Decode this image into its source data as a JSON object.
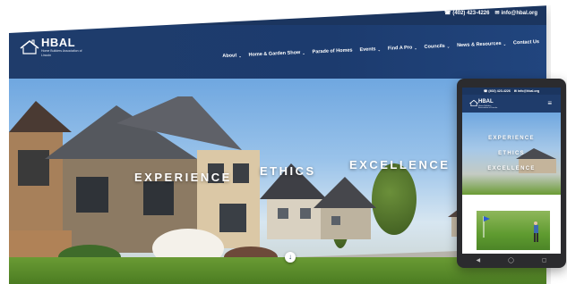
{
  "desktop": {
    "topbar": {
      "phone": "(402) 423-4226",
      "email": "info@hbal.org"
    },
    "logo": {
      "main": "HBAL",
      "sub": "Home Builders Association of Lincoln"
    },
    "nav": [
      {
        "label": "About",
        "has_dropdown": true
      },
      {
        "label": "Home & Garden Show",
        "has_dropdown": true
      },
      {
        "label": "Parade of Homes",
        "has_dropdown": false
      },
      {
        "label": "Events",
        "has_dropdown": true
      },
      {
        "label": "Find A Pro",
        "has_dropdown": true
      },
      {
        "label": "Councils",
        "has_dropdown": true
      },
      {
        "label": "News & Resources",
        "has_dropdown": true
      },
      {
        "label": "Contact Us",
        "has_dropdown": false
      }
    ],
    "hero": {
      "words": [
        "EXPERIENCE",
        "ETHICS",
        "EXCELLENCE"
      ]
    }
  },
  "phone": {
    "topbar": {
      "phone": "(402) 423-4226",
      "email": "info@hbal.org"
    },
    "logo": {
      "main": "HBAL",
      "sub": "Home Builders Association of Lincoln"
    },
    "hero": {
      "words": [
        "EXPERIENCE",
        "ETHICS",
        "EXCELLENCE"
      ]
    }
  },
  "colors": {
    "navy": "#1b355f",
    "nav_bg": "#1f3c6b",
    "sky": "#6fa7e0",
    "lawn": "#5f9b30"
  }
}
